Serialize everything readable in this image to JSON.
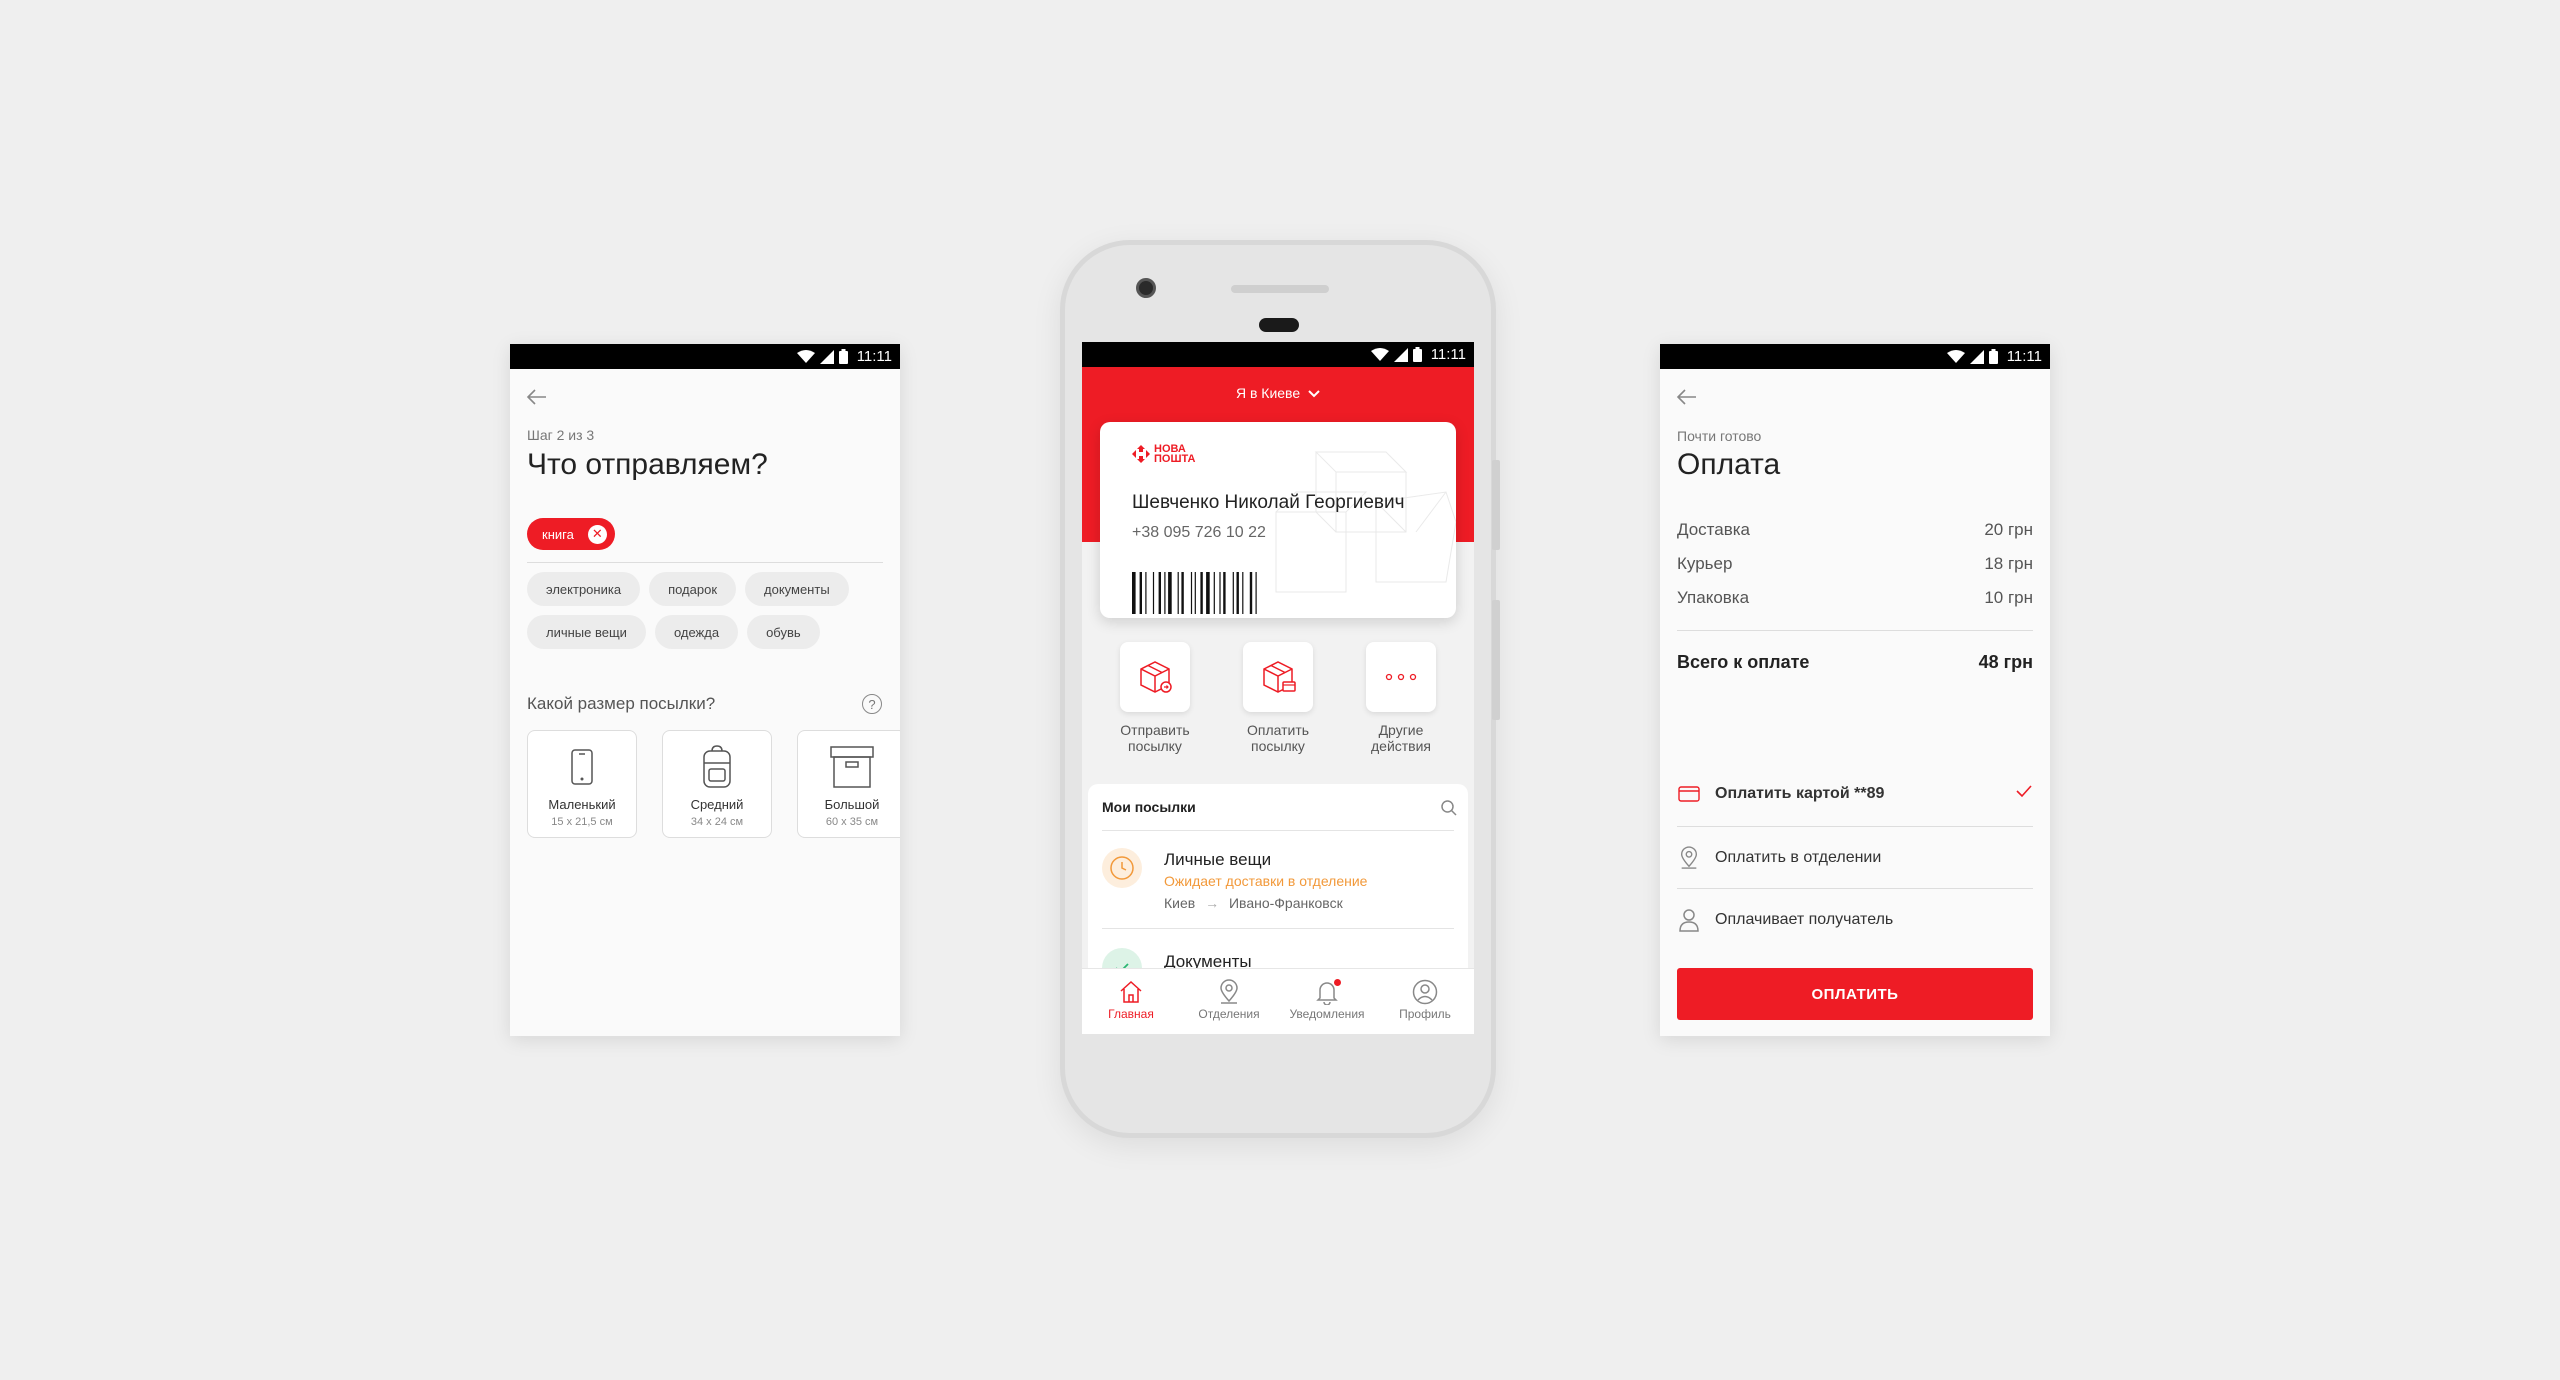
{
  "statusbar": {
    "time": "11:11"
  },
  "left": {
    "step": "Шаг 2 из 3",
    "title": "Что отправляем?",
    "selected_tag": "книга",
    "tags": [
      "электроника",
      "подарок",
      "документы",
      "личные вещи",
      "одежда",
      "обувь"
    ],
    "size_question": "Какой размер посылки?",
    "help": "?",
    "sizes": [
      {
        "name": "Маленький",
        "dims": "15 x 21,5 см"
      },
      {
        "name": "Средний",
        "dims": "34 x 24 см"
      },
      {
        "name": "Большой",
        "dims": "60 x 35 см"
      }
    ]
  },
  "center": {
    "city": "Я в Киеве",
    "logo": {
      "line1": "НОВА",
      "line2": "ПОШТА"
    },
    "card_name": "Шевченко Николай Георгиевич",
    "card_phone": "+38 095 726 10 22",
    "actions": [
      {
        "line1": "Отправить",
        "line2": "посылку"
      },
      {
        "line1": "Оплатить",
        "line2": "посылку"
      },
      {
        "line1": "Другие",
        "line2": "действия"
      }
    ],
    "parcels_title": "Мои посылки",
    "parcels": [
      {
        "name": "Личные вещи",
        "status": "Ожидает доставки в отделение",
        "from": "Киев",
        "to": "Ивано-Франковск"
      },
      {
        "name": "Документы"
      }
    ],
    "tabs": [
      "Главная",
      "Отделения",
      "Уведомления",
      "Профиль"
    ]
  },
  "right": {
    "subtitle": "Почти готово",
    "title": "Оплата",
    "items": [
      {
        "label": "Доставка",
        "value": "20 грн"
      },
      {
        "label": "Курьер",
        "value": "18 грн"
      },
      {
        "label": "Упаковка",
        "value": "10 грн"
      }
    ],
    "total_label": "Всего к оплате",
    "total_value": "48 грн",
    "options": [
      "Оплатить картой **89",
      "Оплатить в отделении",
      "Оплачивает получатель"
    ],
    "pay_button": "ОПЛАТИТЬ"
  },
  "colors": {
    "brand_red": "#ee1c25",
    "status_orange": "#f2993a",
    "delivered_green": "#2bb673"
  }
}
